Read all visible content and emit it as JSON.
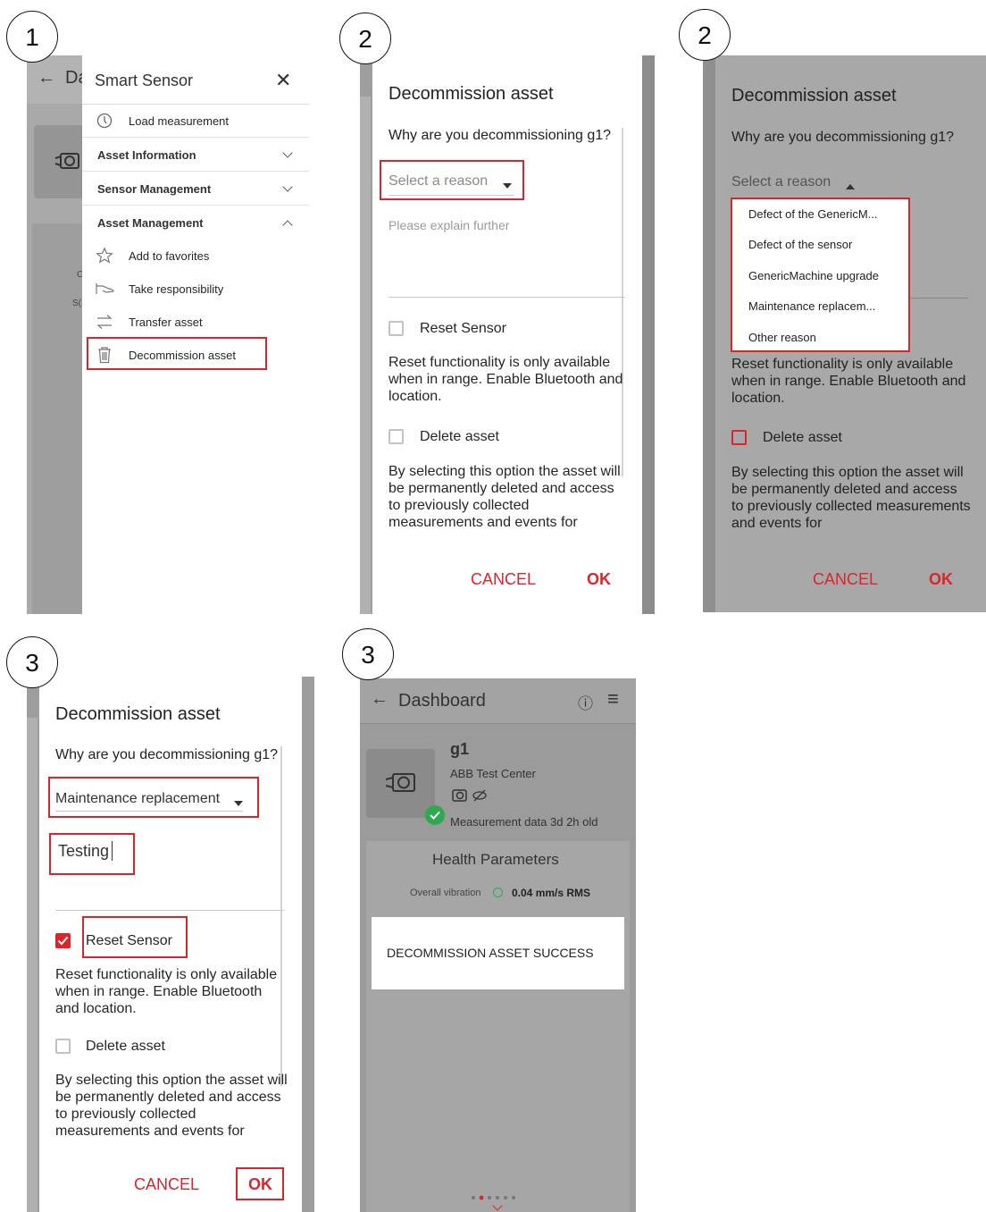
{
  "steps": [
    "1",
    "2",
    "2",
    "3",
    "3"
  ],
  "panel1": {
    "back_arrow": "←",
    "dashboard_fragment": "Da",
    "menu_title": "Smart Sensor",
    "close_glyph": "✕",
    "items": [
      {
        "label": "Load measurement",
        "icon": "gauge-icon"
      },
      {
        "label": "Asset Information",
        "icon": "chevron-down-icon"
      },
      {
        "label": "Sensor Management",
        "icon": "chevron-down-icon"
      },
      {
        "label": "Asset Management",
        "icon": "chevron-up-icon"
      },
      {
        "label": "Add to favorites",
        "icon": "star-icon"
      },
      {
        "label": "Take responsibility",
        "icon": "hand-icon"
      },
      {
        "label": "Transfer asset",
        "icon": "transfer-icon"
      },
      {
        "label": "Decommission asset",
        "icon": "trash-icon"
      }
    ],
    "underlay_fragments": [
      "C",
      "S("
    ]
  },
  "dialog": {
    "title": "Decommission asset",
    "question": "Why are you decommissioning g1?",
    "select_placeholder": "Select a reason",
    "explain_placeholder": "Please explain further",
    "reset_label": "Reset Sensor",
    "reset_help": "Reset functionality is only available when in range. Enable Bluetooth and location.",
    "delete_label": "Delete asset",
    "delete_help": "By selecting this option the asset will be permanently deleted and access to previously collected measurements and events for",
    "cancel": "CANCEL",
    "ok": "OK"
  },
  "panel3": {
    "options": [
      "Defect of the GenericM...",
      "Defect of the sensor",
      "GenericMachine upgrade",
      "Maintenance replacem...",
      "Other reason"
    ]
  },
  "panel4": {
    "selected_reason": "Maintenance replacement",
    "explanation": "Testing"
  },
  "panel5": {
    "back_arrow": "←",
    "title": "Dashboard",
    "info_glyph": "ⓘ",
    "menu_glyph": "≡",
    "asset_name": "g1",
    "location": "ABB Test Center",
    "measurement_age": "Measurement data 3d 2h old",
    "health_title": "Health Parameters",
    "vibration_label": "Overall vibration",
    "vibration_value": "0.04 mm/s RMS",
    "toast": "DECOMMISSION ASSET SUCCESS"
  },
  "colors": {
    "accent_red": "#d9252c",
    "scrim_gray": "#a8a8a8",
    "status_green": "#2fa84f"
  }
}
